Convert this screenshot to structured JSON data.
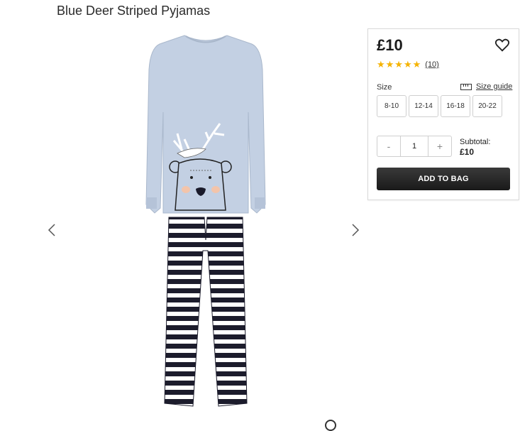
{
  "product": {
    "title": "Blue Deer Striped Pyjamas",
    "image": "pyjamas-photo"
  },
  "gallery": {
    "prev_icon": "chevron-left-icon",
    "next_icon": "chevron-right-icon"
  },
  "panel": {
    "price": "£10",
    "wishlist_icon": "heart-icon",
    "rating": {
      "stars": 5,
      "max": 5,
      "count": "(10)",
      "star_color": "#f5b301"
    },
    "size_label": "Size",
    "size_guide": "Size guide",
    "sizes": [
      "8-10",
      "12-14",
      "16-18",
      "20-22"
    ],
    "quantity": {
      "minus": "-",
      "value": "1",
      "plus": "+"
    },
    "subtotal_label": "Subtotal:",
    "subtotal_value": "£10",
    "add_to_bag": "ADD TO BAG",
    "button_color": "#1f1f1f"
  }
}
